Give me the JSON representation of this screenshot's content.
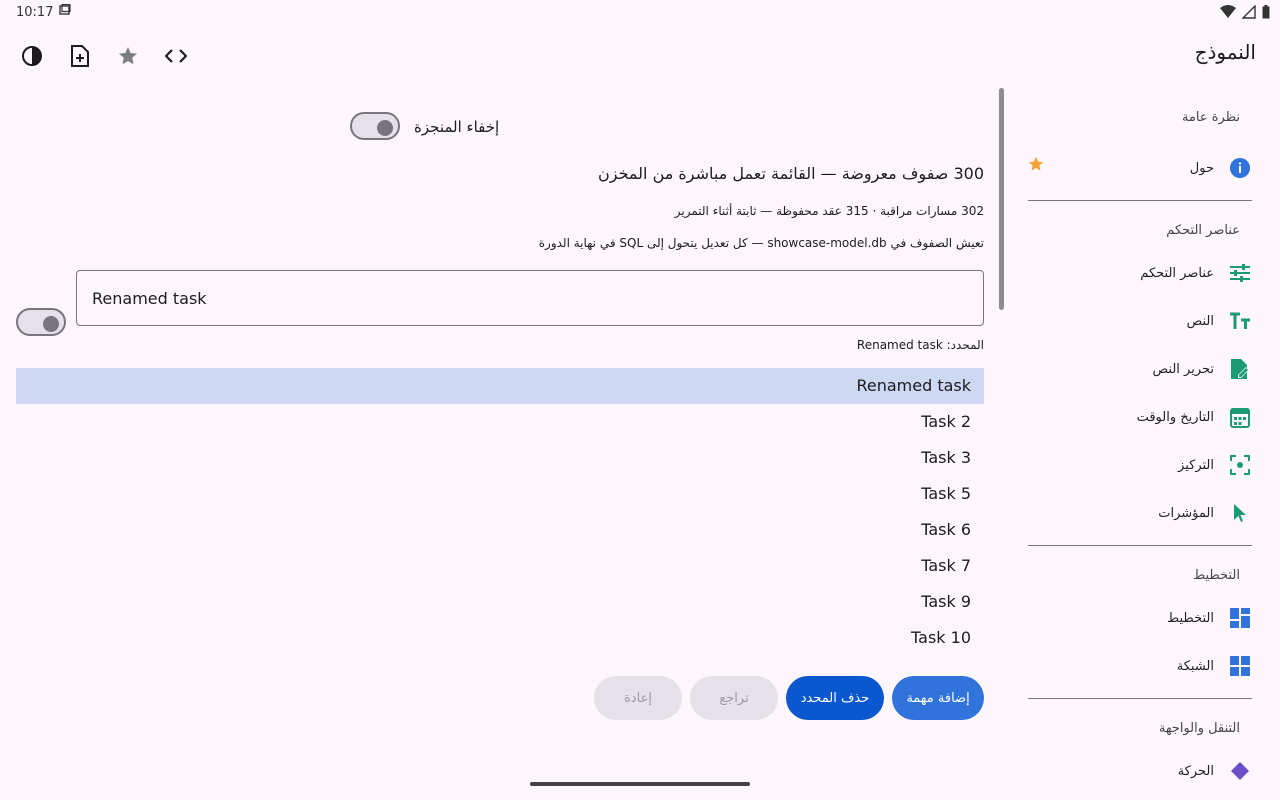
{
  "status": {
    "time": "10:17"
  },
  "topbar": {
    "title": "النموذج"
  },
  "toolbar": {
    "theme_icon": "contrast-icon",
    "new_icon": "note-add-icon",
    "star_icon": "star-icon",
    "code_icon": "code-icon"
  },
  "sidebar": {
    "sections": [
      {
        "title": "نظرة عامة",
        "items": [
          {
            "label": "حول",
            "icon": "info-icon",
            "starred": true
          }
        ]
      },
      {
        "title": "عناصر التحكم",
        "items": [
          {
            "label": "عناصر التحكم",
            "icon": "tune-icon"
          },
          {
            "label": "النص",
            "icon": "text-fields-icon"
          },
          {
            "label": "تحرير النص",
            "icon": "edit-document-icon"
          },
          {
            "label": "التاريخ والوقت",
            "icon": "calendar-icon"
          },
          {
            "label": "التركيز",
            "icon": "center-focus-icon"
          },
          {
            "label": "المؤشرات",
            "icon": "pointer-icon"
          }
        ]
      },
      {
        "title": "التخطيط",
        "items": [
          {
            "label": "التخطيط",
            "icon": "dashboard-icon"
          },
          {
            "label": "الشبكة",
            "icon": "grid-icon"
          }
        ]
      },
      {
        "title": "التنقل والواجهة",
        "items": [
          {
            "label": "الحركة",
            "icon": "navigation-icon"
          }
        ]
      }
    ]
  },
  "main": {
    "hide_done_label": "إخفاء المنجزة",
    "headline": "300 صفوف معروضة — القائمة تعمل مباشرة من المخزن",
    "stats": "302 مسارات مراقبة · 315 عقد محفوظة — ثابتة أثناء التمرير",
    "storage_note": "تعيش الصفوف في showcase-model.db — كل تعديل يتحول إلى SQL في نهاية الدورة",
    "task_field_value": "Renamed task",
    "selected_prefix": "المحدد:",
    "selected_value": "Renamed task",
    "tasks": [
      "Renamed task",
      "Task 2",
      "Task 3",
      "Task 5",
      "Task 6",
      "Task 7",
      "Task 9",
      "Task 10"
    ],
    "buttons": {
      "add": "إضافة مهمة",
      "delete": "حذف المحدد",
      "undo": "تراجع",
      "redo": "إعادة"
    }
  },
  "colors": {
    "primary": "#0b57d0",
    "primary_light": "#2f73db",
    "selection": "#cdd9f3",
    "disabled_bg": "#e6e0e9",
    "teal_icon": "#1c9b73",
    "blue_icon": "#2f73db",
    "star": "#f2a33a"
  }
}
